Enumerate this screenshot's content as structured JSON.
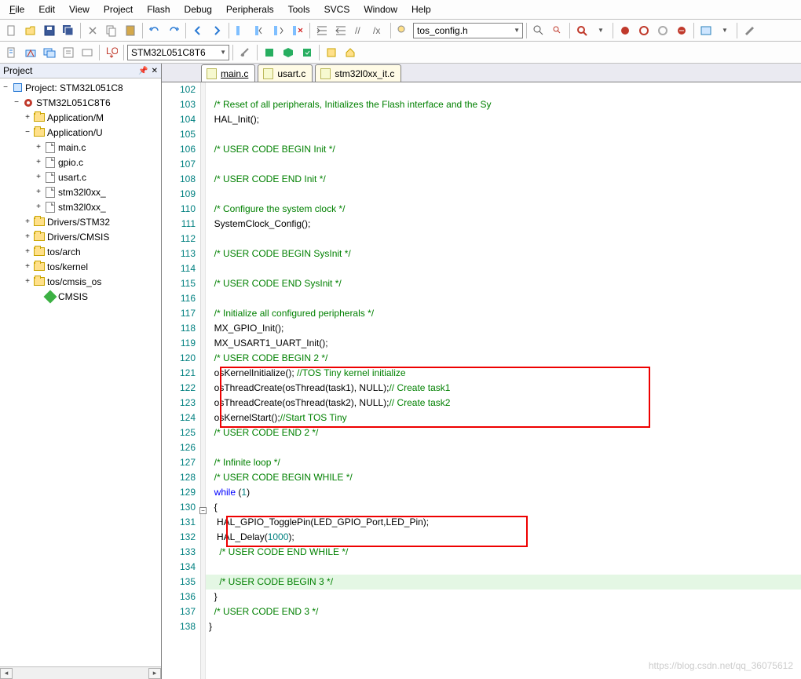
{
  "menu": {
    "file": "File",
    "edit": "Edit",
    "view": "View",
    "project": "Project",
    "flash": "Flash",
    "debug": "Debug",
    "peripherals": "Peripherals",
    "tools": "Tools",
    "svcs": "SVCS",
    "window": "Window",
    "help": "Help"
  },
  "toolbar": {
    "combo1": "tos_config.h",
    "device": "STM32L051C8T6"
  },
  "panel": {
    "title": "Project"
  },
  "tree": {
    "root": "Project: STM32L051C8",
    "target": "STM32L051C8T6",
    "grp_appM": "Application/M",
    "grp_appU": "Application/U",
    "f_main": "main.c",
    "f_gpio": "gpio.c",
    "f_usart": "usart.c",
    "f_stm1": "stm32l0xx_",
    "f_stm2": "stm32l0xx_",
    "grp_drvSTM": "Drivers/STM32",
    "grp_drvCMS": "Drivers/CMSIS",
    "grp_tosA": "tos/arch",
    "grp_tosK": "tos/kernel",
    "grp_tosC": "tos/cmsis_os",
    "grp_cmsis": "CMSIS"
  },
  "tabs": {
    "main": "main.c",
    "usart": "usart.c",
    "stmit": "stm32l0xx_it.c"
  },
  "code": {
    "lines": [
      {
        "n": 102,
        "t": ""
      },
      {
        "n": 103,
        "t": "  /* Reset of all peripherals, Initializes the Flash interface and the Sy",
        "c": "ccom"
      },
      {
        "n": 104,
        "t": "  HAL_Init();"
      },
      {
        "n": 105,
        "t": ""
      },
      {
        "n": 106,
        "t": "  /* USER CODE BEGIN Init */",
        "c": "ccom"
      },
      {
        "n": 107,
        "t": ""
      },
      {
        "n": 108,
        "t": "  /* USER CODE END Init */",
        "c": "ccom"
      },
      {
        "n": 109,
        "t": ""
      },
      {
        "n": 110,
        "t": "  /* Configure the system clock */",
        "c": "ccom"
      },
      {
        "n": 111,
        "t": "  SystemClock_Config();"
      },
      {
        "n": 112,
        "t": ""
      },
      {
        "n": 113,
        "t": "  /* USER CODE BEGIN SysInit */",
        "c": "ccom"
      },
      {
        "n": 114,
        "t": ""
      },
      {
        "n": 115,
        "t": "  /* USER CODE END SysInit */",
        "c": "ccom"
      },
      {
        "n": 116,
        "t": ""
      },
      {
        "n": 117,
        "t": "  /* Initialize all configured peripherals */",
        "c": "ccom"
      },
      {
        "n": 118,
        "t": "  MX_GPIO_Init();"
      },
      {
        "n": 119,
        "t": "  MX_USART1_UART_Init();"
      },
      {
        "n": 120,
        "t": "  /* USER CODE BEGIN 2 */",
        "c": "ccom"
      },
      {
        "n": 121,
        "html": "  osKernelInitialize(); <span class=\"ccom\">//TOS Tiny kernel initialize</span>"
      },
      {
        "n": 122,
        "html": "  osThreadCreate(osThread(task1), NULL);<span class=\"ccom\">// Create task1</span>"
      },
      {
        "n": 123,
        "html": "  osThreadCreate(osThread(task2), NULL);<span class=\"ccom\">// Create task2</span>"
      },
      {
        "n": 124,
        "html": "  osKernelStart();<span class=\"ccom\">//Start TOS Tiny</span>"
      },
      {
        "n": 125,
        "t": "  /* USER CODE END 2 */",
        "c": "ccom"
      },
      {
        "n": 126,
        "t": ""
      },
      {
        "n": 127,
        "t": "  /* Infinite loop */",
        "c": "ccom"
      },
      {
        "n": 128,
        "t": "  /* USER CODE BEGIN WHILE */",
        "c": "ccom"
      },
      {
        "n": 129,
        "html": "  <span class=\"ckey\">while</span> (<span class=\"cnum\">1</span>)"
      },
      {
        "n": 130,
        "t": "  {"
      },
      {
        "n": 131,
        "t": "   HAL_GPIO_TogglePin(LED_GPIO_Port,LED_Pin);"
      },
      {
        "n": 132,
        "html": "   HAL_Delay(<span class=\"cnum\">1000</span>);"
      },
      {
        "n": 133,
        "t": "    /* USER CODE END WHILE */",
        "c": "ccom"
      },
      {
        "n": 134,
        "t": ""
      },
      {
        "n": 135,
        "t": "    /* USER CODE BEGIN 3 */",
        "c": "ccom",
        "hl": true
      },
      {
        "n": 136,
        "t": "  }"
      },
      {
        "n": 137,
        "t": "  /* USER CODE END 3 */",
        "c": "ccom"
      },
      {
        "n": 138,
        "t": "}"
      }
    ]
  },
  "watermark": "https://blog.csdn.net/qq_36075612"
}
